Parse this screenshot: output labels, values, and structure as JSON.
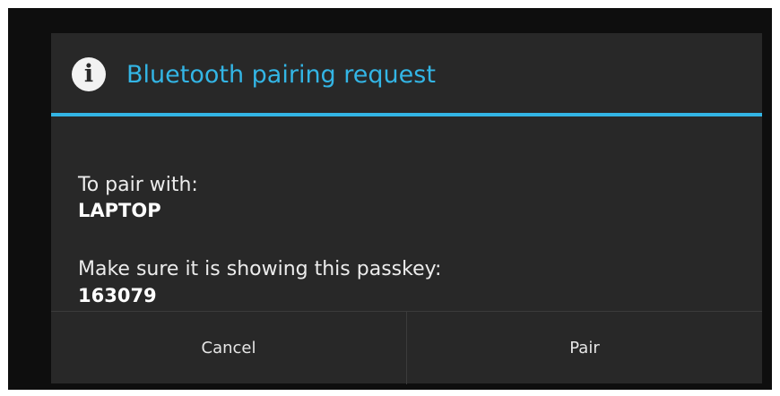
{
  "dialog": {
    "icon": "info-icon",
    "title": "Bluetooth pairing request",
    "accent_color": "#33b5e5",
    "background_color": "#282828",
    "pair_with_label": "To pair with:",
    "device_name": "LAPTOP",
    "passkey_label": "Make sure it is showing this passkey:",
    "passkey": "163079",
    "buttons": {
      "cancel_label": "Cancel",
      "pair_label": "Pair"
    }
  }
}
